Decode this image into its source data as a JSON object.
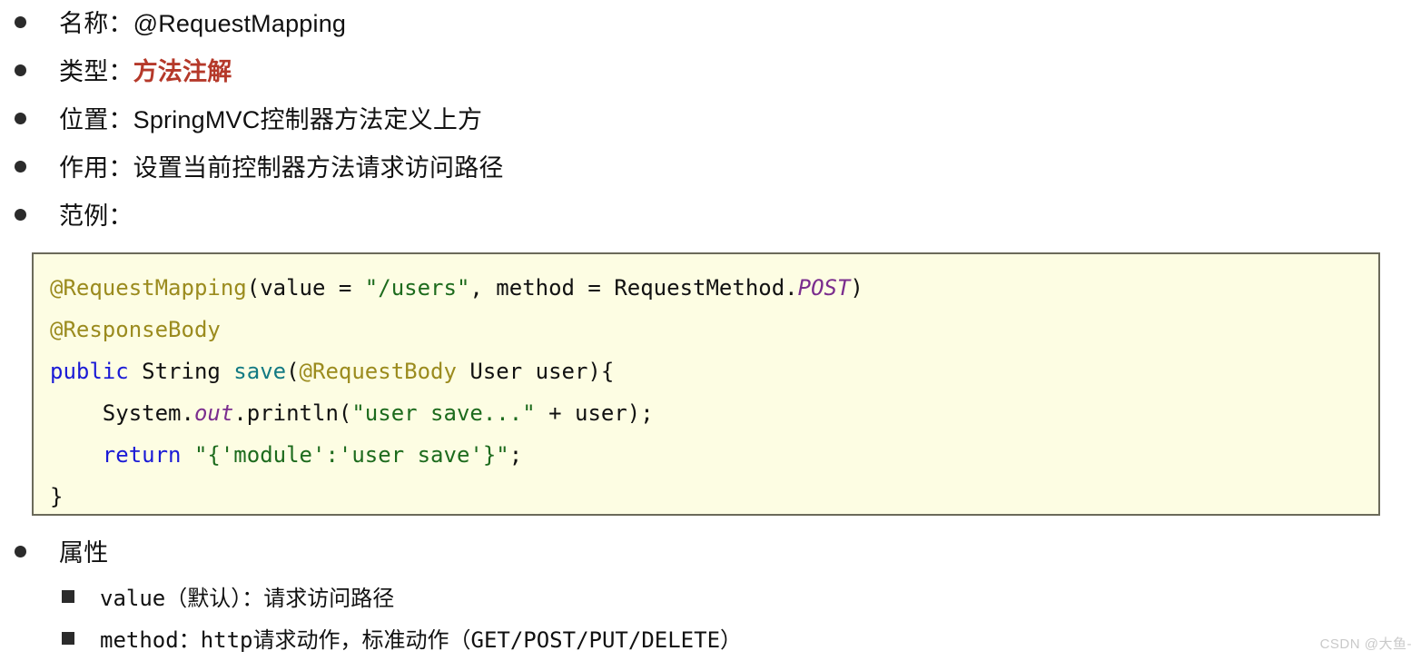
{
  "doc": {
    "title": "@RequestMapping",
    "bullet_icons": {
      "level1": "disc-bullet",
      "level2": "square-bullet"
    }
  },
  "top_list": [
    {
      "label": "名称：",
      "value": "@RequestMapping",
      "accent": false
    },
    {
      "label": "类型：",
      "value": "方法注解",
      "accent": true
    },
    {
      "label": "位置：",
      "value": "SpringMVC控制器方法定义上方",
      "accent": false
    },
    {
      "label": "作用：",
      "value": "设置当前控制器方法请求访问路径",
      "accent": false
    },
    {
      "label": "范例：",
      "value": "",
      "accent": false
    }
  ],
  "code_block": {
    "language": "java",
    "lines": [
      [
        {
          "t": "@RequestMapping",
          "c": "ann"
        },
        {
          "t": "(value = ",
          "c": "plain"
        },
        {
          "t": "\"/users\"",
          "c": "str"
        },
        {
          "t": ", method = RequestMethod.",
          "c": "plain"
        },
        {
          "t": "POST",
          "c": "static"
        },
        {
          "t": ")",
          "c": "plain"
        }
      ],
      [
        {
          "t": "@ResponseBody",
          "c": "ann"
        }
      ],
      [
        {
          "t": "public",
          "c": "kw"
        },
        {
          "t": " String ",
          "c": "plain"
        },
        {
          "t": "save",
          "c": "method"
        },
        {
          "t": "(",
          "c": "plain"
        },
        {
          "t": "@RequestBody",
          "c": "ann"
        },
        {
          "t": " User user){",
          "c": "plain"
        }
      ],
      [
        {
          "t": "    System.",
          "c": "plain"
        },
        {
          "t": "out",
          "c": "static"
        },
        {
          "t": ".println(",
          "c": "plain"
        },
        {
          "t": "\"user save...\"",
          "c": "str"
        },
        {
          "t": " + user);",
          "c": "plain"
        }
      ],
      [
        {
          "t": "    ",
          "c": "plain"
        },
        {
          "t": "return",
          "c": "kw"
        },
        {
          "t": " ",
          "c": "plain"
        },
        {
          "t": "\"{'module':'user save'}\"",
          "c": "str"
        },
        {
          "t": ";",
          "c": "plain"
        }
      ],
      [
        {
          "t": "}",
          "c": "plain"
        }
      ]
    ],
    "plain_text": "@RequestMapping(value = \"/users\", method = RequestMethod.POST)\n@ResponseBody\npublic String save(@RequestBody User user){\n    System.out.println(\"user save...\" + user);\n    return \"{'module':'user save'}\";\n}"
  },
  "bottom_list": {
    "heading": "属性",
    "items": [
      "value（默认）：请求访问路径",
      "method：http请求动作，标准动作（GET/POST/PUT/DELETE）"
    ]
  },
  "watermark": "CSDN @大鱼-",
  "colors": {
    "page_background": "#ffffff",
    "accent_red": "#b5392a",
    "code_background": "#fdfde3",
    "code_border": "#6b6a5a",
    "token_annotation": "#9b8b1e",
    "token_keyword": "#1a1ad6",
    "token_string": "#1d6b1d",
    "token_method": "#137a83",
    "token_static": "#7b2d8e",
    "bullet": "#2b2b2b",
    "watermark": "#c9c9c9"
  }
}
